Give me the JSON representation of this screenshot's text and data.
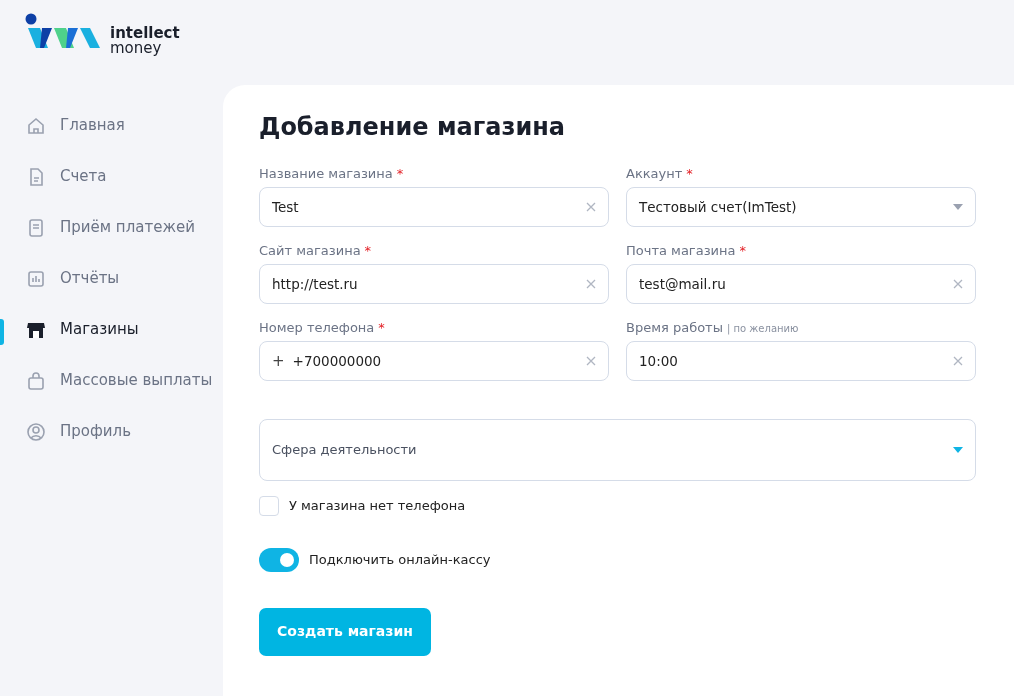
{
  "logo": {
    "line_1": "intellect",
    "line_2": "money"
  },
  "sidebar": {
    "items": [
      {
        "label": "Главная",
        "selected": false
      },
      {
        "label": "Счета",
        "selected": false
      },
      {
        "label": "Приём платежей",
        "selected": false
      },
      {
        "label": "Отчёты",
        "selected": false
      },
      {
        "label": "Магазины",
        "selected": true
      },
      {
        "label": "Массовые выплаты",
        "selected": false
      },
      {
        "label": "Профиль",
        "selected": false
      }
    ]
  },
  "page": {
    "title": "Добавление магазина"
  },
  "fields": [
    {
      "kind": "text",
      "label": "Название магазина",
      "required_mark": "*",
      "value": "Test"
    },
    {
      "kind": "select",
      "label": "Аккаунт",
      "required_mark": "*",
      "value": "Тестовый счет(ImTest)"
    },
    {
      "kind": "text",
      "label": "Сайт магазина",
      "required_mark": "*",
      "value": "http://test.ru"
    },
    {
      "kind": "text",
      "label": "Почта магазина",
      "required_mark": "*",
      "value": "test@mail.ru"
    },
    {
      "kind": "text",
      "label": "Номер телефона",
      "required_mark": "*",
      "prefix": "+",
      "value": "+700000000"
    },
    {
      "kind": "text",
      "label": "Время работы",
      "note": "| по желанию",
      "value": "10:00"
    }
  ],
  "activity_select": {
    "placeholder": "Сфера деятельности"
  },
  "no_phone_checkbox": {
    "label": "У магазина нет телефона",
    "checked": false
  },
  "online_cash_toggle": {
    "label": "Подключить онлайн-кассу",
    "on": true
  },
  "submit_button": {
    "label": "Создать магазин"
  }
}
